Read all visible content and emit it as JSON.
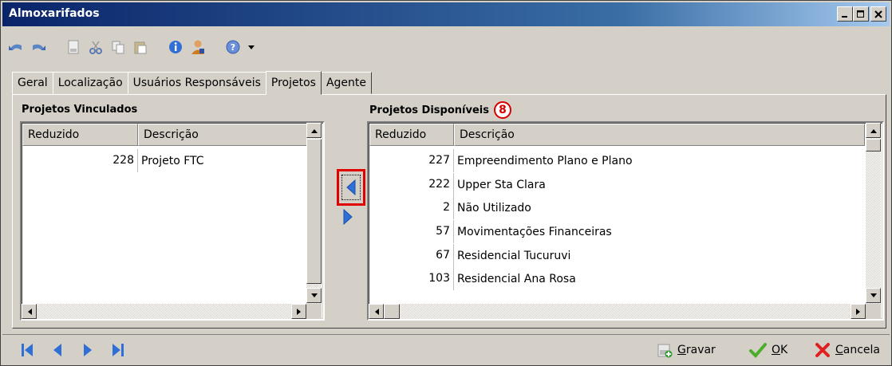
{
  "window": {
    "title": "Almoxarifados"
  },
  "toolbar": {
    "icons": [
      "undo-icon",
      "redo-icon",
      "new-doc-icon",
      "cut-icon",
      "copy-icon",
      "paste-icon",
      "info-icon",
      "user-icon",
      "help-icon",
      "dropdown-arrow-icon"
    ]
  },
  "tabs": [
    {
      "label": "Geral"
    },
    {
      "label": "Localização"
    },
    {
      "label": "Usuários Responsáveis"
    },
    {
      "label": "Projetos",
      "active": true
    },
    {
      "label": "Agente"
    }
  ],
  "linked": {
    "title": "Projetos Vinculados",
    "col_reduzido": "Reduzido",
    "col_descricao": "Descrição",
    "rows": [
      {
        "reduzido": "228",
        "descricao": "Projeto FTC"
      }
    ]
  },
  "available": {
    "title": "Projetos Disponíveis",
    "badge": "8",
    "col_reduzido": "Reduzido",
    "col_descricao": "Descrição",
    "rows": [
      {
        "reduzido": "227",
        "descricao": "Empreendimento Plano e Plano"
      },
      {
        "reduzido": "222",
        "descricao": "Upper Sta Clara"
      },
      {
        "reduzido": "2",
        "descricao": "Não Utilizado"
      },
      {
        "reduzido": "57",
        "descricao": "Movimentações Financeiras"
      },
      {
        "reduzido": "67",
        "descricao": "Residencial Tucuruvi"
      },
      {
        "reduzido": "103",
        "descricao": "Residencial Ana Rosa"
      }
    ]
  },
  "actions": {
    "gravar": "Gravar",
    "ok": "OK",
    "cancelar": "Cancela"
  },
  "colors": {
    "title_bar": "#0a246a",
    "highlight": "#e00000",
    "arrow_blue": "#2f6fd6"
  }
}
